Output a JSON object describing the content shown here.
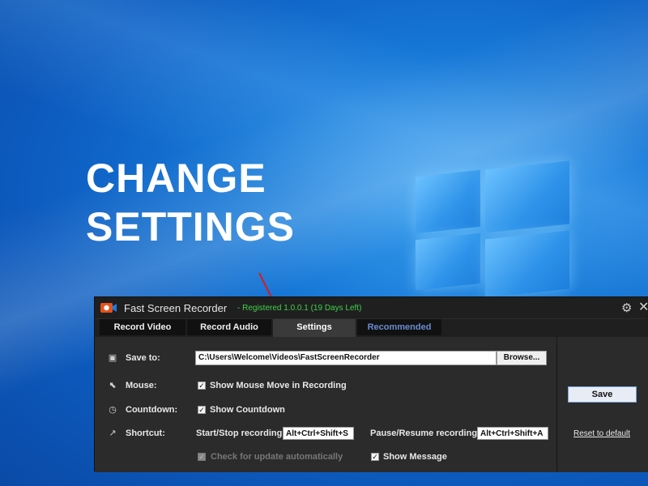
{
  "headline": {
    "line1": "CHANGE",
    "line2": "SETTINGS"
  },
  "window": {
    "title": "Fast Screen Recorder",
    "registration": "- Registered 1.0.0.1 (19 Days Left)",
    "gear_icon": "gear-icon",
    "close_icon": "close-icon"
  },
  "tabs": [
    {
      "label": "Record Video"
    },
    {
      "label": "Record Audio"
    },
    {
      "label": "Settings",
      "active": true
    },
    {
      "label": "Recommended"
    }
  ],
  "settings": {
    "save_to": {
      "label": "Save to:",
      "value": "C:\\Users\\Welcome\\Videos\\FastScreenRecorder",
      "browse": "Browse..."
    },
    "mouse": {
      "label": "Mouse:",
      "option": "Show Mouse Move in Recording",
      "checked": true
    },
    "countdown": {
      "label": "Countdown:",
      "option": "Show Countdown",
      "checked": true
    },
    "shortcut": {
      "label": "Shortcut:",
      "start_stop_label": "Start/Stop recording",
      "start_stop_value": "Alt+Ctrl+Shift+S",
      "pause_resume_label": "Pause/Resume recording",
      "pause_resume_value": "Alt+Ctrl+Shift+A"
    },
    "check_update": {
      "label": "Check for update automatically",
      "checked": true,
      "disabled": true
    },
    "show_message": {
      "label": "Show Message",
      "checked": true
    },
    "save_button": "Save",
    "reset_link": "Reset to default"
  },
  "colors": {
    "accent_green": "#3fd14a",
    "arrow_red": "#d81b1b",
    "tab_active": "#3a3a3a"
  }
}
